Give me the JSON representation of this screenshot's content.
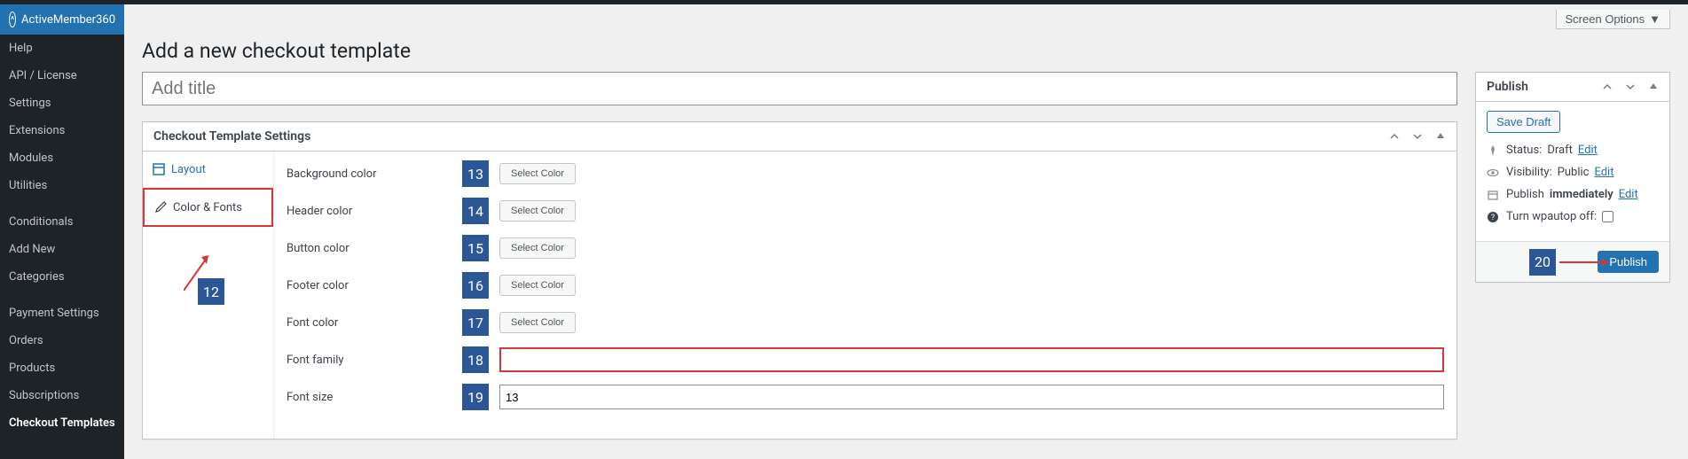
{
  "sidebar": {
    "items": [
      {
        "label": "ActiveMember360",
        "active": true
      },
      {
        "label": "Help"
      },
      {
        "label": "API / License"
      },
      {
        "label": "Settings"
      },
      {
        "label": "Extensions"
      },
      {
        "label": "Modules"
      },
      {
        "label": "Utilities"
      },
      {
        "label": "Conditionals"
      },
      {
        "label": "Add New"
      },
      {
        "label": "Categories"
      },
      {
        "label": "Payment Settings"
      },
      {
        "label": "Orders"
      },
      {
        "label": "Products"
      },
      {
        "label": "Subscriptions"
      },
      {
        "label": "Checkout Templates",
        "current": true
      }
    ]
  },
  "screen_options": "Screen Options",
  "page_title": "Add a new checkout template",
  "title_placeholder": "Add title",
  "settings_box": {
    "title": "Checkout Template Settings",
    "tabs": {
      "layout": "Layout",
      "color_fonts": "Color & Fonts"
    },
    "fields": {
      "background_color": {
        "label": "Background color",
        "num": "13",
        "btn": "Select Color"
      },
      "header_color": {
        "label": "Header color",
        "num": "14",
        "btn": "Select Color"
      },
      "button_color": {
        "label": "Button color",
        "num": "15",
        "btn": "Select Color"
      },
      "footer_color": {
        "label": "Footer color",
        "num": "16",
        "btn": "Select Color"
      },
      "font_color": {
        "label": "Font color",
        "num": "17",
        "btn": "Select Color"
      },
      "font_family": {
        "label": "Font family",
        "num": "18",
        "value": ""
      },
      "font_size": {
        "label": "Font size",
        "num": "19",
        "value": "13"
      }
    }
  },
  "annotations": {
    "twelve": "12",
    "twenty": "20"
  },
  "publish_box": {
    "title": "Publish",
    "save_draft": "Save Draft",
    "status_label": "Status:",
    "status_value": "Draft",
    "visibility_label": "Visibility:",
    "visibility_value": "Public",
    "publish_label": "Publish",
    "immediately": "immediately",
    "wpautop": "Turn wpautop off:",
    "edit": "Edit",
    "publish_btn": "Publish"
  }
}
